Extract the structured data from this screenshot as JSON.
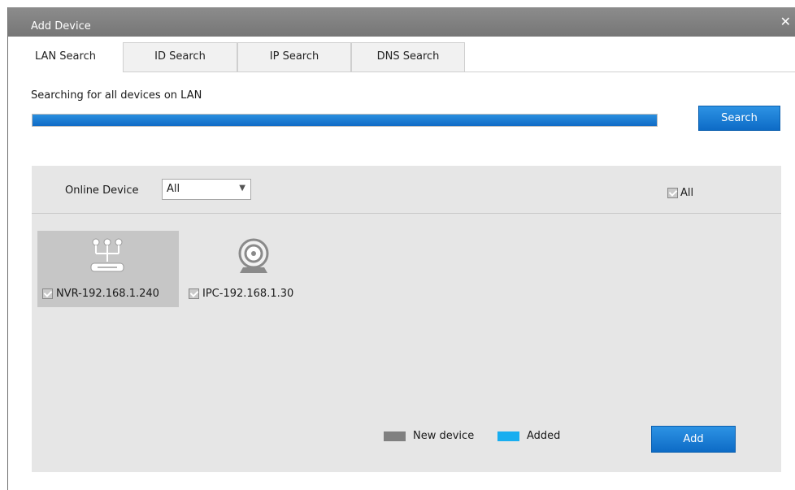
{
  "dialog": {
    "title": "Add Device",
    "close_icon": "close-icon"
  },
  "tabs": [
    {
      "label": "LAN Search",
      "active": true
    },
    {
      "label": "ID Search",
      "active": false
    },
    {
      "label": "IP Search",
      "active": false
    },
    {
      "label": "DNS Search",
      "active": false
    }
  ],
  "search": {
    "status_text": "Searching for all devices on LAN",
    "progress_percent": 100,
    "button_label": "Search"
  },
  "devices_panel": {
    "filter_label": "Online Device",
    "filter_value": "All",
    "select_all_label": "All",
    "select_all_checked": true,
    "devices": [
      {
        "label": "NVR-192.168.1.240",
        "icon": "nvr-network-icon",
        "checked": true,
        "selected": true
      },
      {
        "label": "IPC-192.168.1.30",
        "icon": "ip-camera-icon",
        "checked": true,
        "selected": false
      }
    ],
    "legend": [
      {
        "label": "New device",
        "color": "#808080"
      },
      {
        "label": "Added",
        "color": "#19aef0"
      }
    ],
    "add_button_label": "Add"
  },
  "colors": {
    "accent": "#1a7fd6",
    "titlebar": "#7f7f7f"
  }
}
